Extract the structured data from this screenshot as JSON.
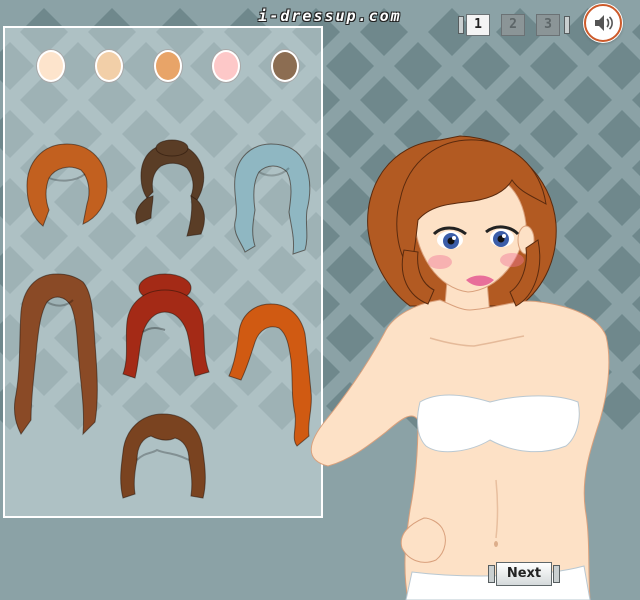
{
  "header": {
    "site_logo": "i-dressup.com",
    "page_tabs": [
      {
        "label": "1",
        "active": true
      },
      {
        "label": "2",
        "active": false
      },
      {
        "label": "3",
        "active": false
      }
    ],
    "sound_icon": "speaker-icon"
  },
  "background": {
    "base_color": "#8ba2a6",
    "diamond_color": "#6f888c"
  },
  "skin_tones": [
    {
      "name": "porcelain",
      "color": "#fde4cc"
    },
    {
      "name": "beige",
      "color": "#f2cfa8"
    },
    {
      "name": "tan",
      "color": "#e8a468"
    },
    {
      "name": "pink",
      "color": "#fdc8c8"
    },
    {
      "name": "brown",
      "color": "#8c6d52"
    }
  ],
  "hairstyles": [
    {
      "name": "auburn-bob",
      "color": "#c2601f"
    },
    {
      "name": "brunette-pigtails",
      "color": "#5a3d26"
    },
    {
      "name": "blue-wavy",
      "color": "#8fb7c2"
    },
    {
      "name": "long-straight-brown",
      "color": "#8a4a26"
    },
    {
      "name": "red-updo",
      "color": "#a42a16"
    },
    {
      "name": "copper-curly",
      "color": "#d05a12"
    },
    {
      "name": "chestnut-shag",
      "color": "#7a4320"
    }
  ],
  "model": {
    "hair_color": "#b25a22",
    "skin_color": "#fde1c6",
    "eye_color": "#3b5da8",
    "top_color": "#ffffff"
  },
  "footer": {
    "next_label": "Next"
  }
}
